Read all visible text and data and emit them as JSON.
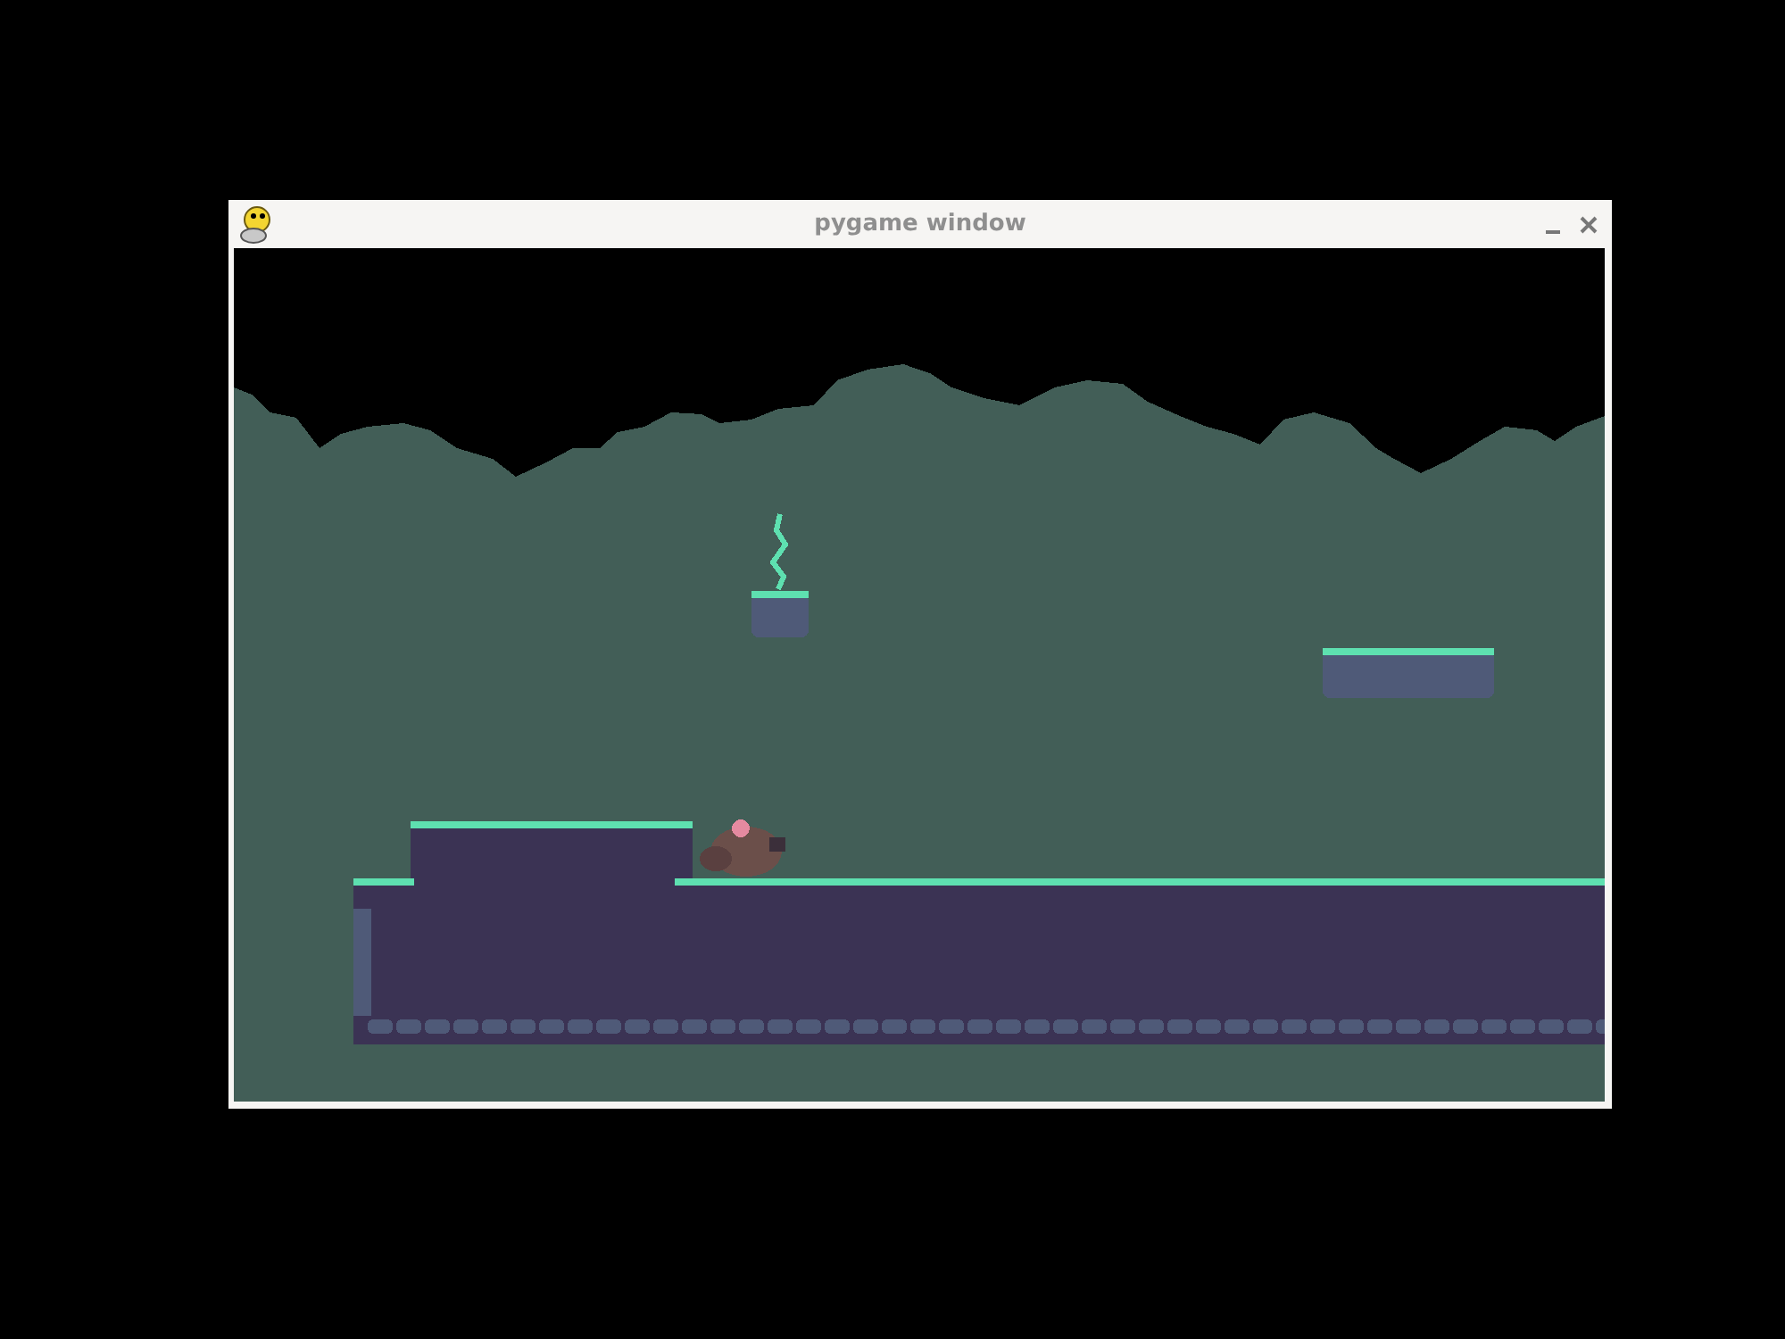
{
  "window": {
    "title": "pygame window"
  }
}
